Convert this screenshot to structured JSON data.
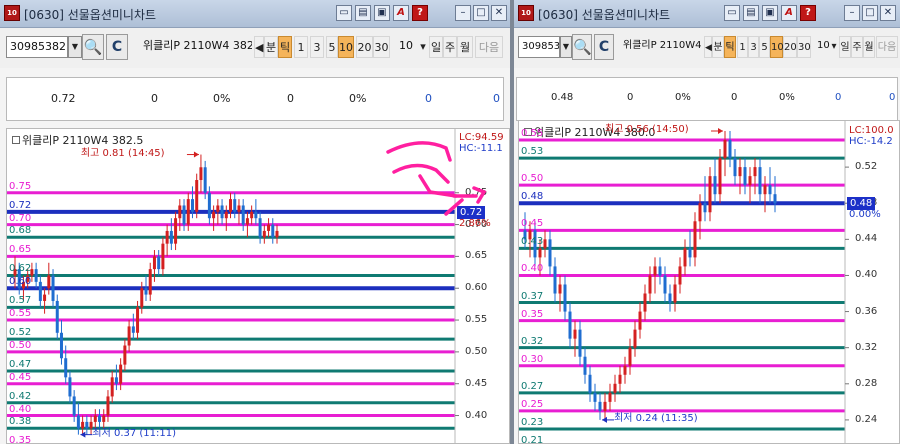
{
  "colors": {
    "magenta": "#e81ed2",
    "teal": "#0f7a72",
    "navy": "#1c2fbe",
    "up": "#d42020",
    "down": "#1f6dd0",
    "annotation": "#ff1fa0"
  },
  "left": {
    "title": "[0630] 선물옵션미니차트",
    "code": "30985382",
    "option_name": "위클리P 2110W4 382.5",
    "interval_buttons": [
      "분",
      "틱",
      "1",
      "3",
      "5",
      "10",
      "20",
      "30"
    ],
    "interval_value": "10",
    "period_buttons": [
      "일",
      "주",
      "월"
    ],
    "next_label": "다음",
    "readout": [
      "0.72",
      "0",
      "0%",
      "0",
      "0%",
      "0",
      "0"
    ],
    "chart_title": "위클리P 2110W4 382.5",
    "high_label": "최고 0.81 (14:45)",
    "low_label": "최저 0.37 (11:11)",
    "lc_label": "LC:94.59",
    "hc_label": "HC:-11.1",
    "current_price": "0.72",
    "change_pct": "2.86%",
    "y_ticks": [
      "0.75",
      "0.70",
      "0.65",
      "0.60",
      "0.55",
      "0.50",
      "0.45",
      "0.40"
    ],
    "level_labels": [
      "0.75",
      "0.72",
      "0.70",
      "0.68",
      "0.65",
      "0.62",
      "0.60",
      "0.57",
      "0.55",
      "0.52",
      "0.50",
      "0.47",
      "0.45",
      "0.42",
      "0.40",
      "0.38",
      "0.35"
    ]
  },
  "right": {
    "title": "[0630] 선물옵션미니차트",
    "code": "30985380",
    "option_name": "위클리P 2110W4 380",
    "interval_buttons": [
      "분",
      "틱",
      "1",
      "3",
      "5",
      "10",
      "20",
      "30"
    ],
    "interval_value": "10",
    "period_buttons": [
      "일",
      "주",
      "월"
    ],
    "next_label": "다음",
    "readout": [
      "0.48",
      "0",
      "0%",
      "0",
      "0%",
      "0",
      "0"
    ],
    "chart_title": "위클리P 2110W4 380.0",
    "high_label": "최고 0.56 (14:50)",
    "low_label": "최저 0.24 (11:35)",
    "lc_label": "LC:100.0",
    "hc_label": "HC:-14.2",
    "current_price": "0.48",
    "change_pct": "0.00%",
    "y_ticks": [
      "0.52",
      "0.48",
      "0.44",
      "0.40",
      "0.36",
      "0.32",
      "0.28",
      "0.24"
    ],
    "level_labels": [
      "0.55",
      "0.53",
      "0.50",
      "0.48",
      "0.45",
      "0.43",
      "0.40",
      "0.37",
      "0.35",
      "0.32",
      "0.30",
      "0.27",
      "0.25",
      "0.23",
      "0.21"
    ]
  },
  "chart_data": [
    {
      "type": "candlestick",
      "title": "위클리P 2110W4 382.5",
      "ylim": [
        0.36,
        0.825
      ],
      "y_ticks": [
        0.75,
        0.7,
        0.65,
        0.6,
        0.55,
        0.5,
        0.45,
        0.4
      ],
      "last": 0.72,
      "high": 0.81,
      "low": 0.37,
      "levels": [
        {
          "v": 0.75,
          "c": "m"
        },
        {
          "v": 0.72,
          "c": "n"
        },
        {
          "v": 0.7,
          "c": "m"
        },
        {
          "v": 0.68,
          "c": "t"
        },
        {
          "v": 0.65,
          "c": "m"
        },
        {
          "v": 0.62,
          "c": "t"
        },
        {
          "v": 0.6,
          "c": "n"
        },
        {
          "v": 0.57,
          "c": "t"
        },
        {
          "v": 0.55,
          "c": "m"
        },
        {
          "v": 0.52,
          "c": "t"
        },
        {
          "v": 0.5,
          "c": "m"
        },
        {
          "v": 0.47,
          "c": "t"
        },
        {
          "v": 0.45,
          "c": "m"
        },
        {
          "v": 0.42,
          "c": "t"
        },
        {
          "v": 0.4,
          "c": "m"
        },
        {
          "v": 0.38,
          "c": "t"
        },
        {
          "v": 0.35,
          "c": "m"
        }
      ],
      "candles": [
        [
          0.62,
          0.65,
          0.6,
          0.63
        ],
        [
          0.63,
          0.64,
          0.59,
          0.6
        ],
        [
          0.6,
          0.62,
          0.58,
          0.61
        ],
        [
          0.61,
          0.63,
          0.6,
          0.62
        ],
        [
          0.62,
          0.64,
          0.61,
          0.63
        ],
        [
          0.63,
          0.64,
          0.6,
          0.61
        ],
        [
          0.61,
          0.62,
          0.57,
          0.58
        ],
        [
          0.58,
          0.6,
          0.56,
          0.59
        ],
        [
          0.6,
          0.64,
          0.59,
          0.62
        ],
        [
          0.62,
          0.63,
          0.57,
          0.58
        ],
        [
          0.58,
          0.59,
          0.52,
          0.53
        ],
        [
          0.53,
          0.55,
          0.48,
          0.49
        ],
        [
          0.49,
          0.51,
          0.45,
          0.46
        ],
        [
          0.46,
          0.47,
          0.42,
          0.43
        ],
        [
          0.43,
          0.44,
          0.39,
          0.4
        ],
        [
          0.4,
          0.42,
          0.37,
          0.38
        ],
        [
          0.38,
          0.4,
          0.37,
          0.39
        ],
        [
          0.39,
          0.4,
          0.37,
          0.38
        ],
        [
          0.38,
          0.4,
          0.37,
          0.39
        ],
        [
          0.39,
          0.41,
          0.38,
          0.4
        ],
        [
          0.4,
          0.41,
          0.38,
          0.39
        ],
        [
          0.39,
          0.41,
          0.38,
          0.4
        ],
        [
          0.4,
          0.44,
          0.39,
          0.43
        ],
        [
          0.43,
          0.47,
          0.42,
          0.46
        ],
        [
          0.46,
          0.48,
          0.44,
          0.45
        ],
        [
          0.45,
          0.49,
          0.44,
          0.48
        ],
        [
          0.48,
          0.52,
          0.47,
          0.51
        ],
        [
          0.51,
          0.55,
          0.5,
          0.54
        ],
        [
          0.54,
          0.56,
          0.52,
          0.53
        ],
        [
          0.53,
          0.58,
          0.52,
          0.57
        ],
        [
          0.57,
          0.61,
          0.56,
          0.6
        ],
        [
          0.6,
          0.62,
          0.58,
          0.59
        ],
        [
          0.59,
          0.64,
          0.58,
          0.63
        ],
        [
          0.63,
          0.66,
          0.61,
          0.65
        ],
        [
          0.65,
          0.66,
          0.62,
          0.63
        ],
        [
          0.63,
          0.68,
          0.62,
          0.67
        ],
        [
          0.67,
          0.7,
          0.65,
          0.69
        ],
        [
          0.69,
          0.71,
          0.66,
          0.67
        ],
        [
          0.67,
          0.72,
          0.66,
          0.71
        ],
        [
          0.71,
          0.74,
          0.69,
          0.73
        ],
        [
          0.73,
          0.74,
          0.69,
          0.7
        ],
        [
          0.7,
          0.75,
          0.69,
          0.74
        ],
        [
          0.74,
          0.76,
          0.71,
          0.72
        ],
        [
          0.72,
          0.78,
          0.71,
          0.77
        ],
        [
          0.77,
          0.81,
          0.75,
          0.79
        ],
        [
          0.79,
          0.8,
          0.74,
          0.75
        ],
        [
          0.75,
          0.76,
          0.7,
          0.71
        ],
        [
          0.71,
          0.73,
          0.69,
          0.72
        ],
        [
          0.72,
          0.74,
          0.7,
          0.73
        ],
        [
          0.73,
          0.74,
          0.7,
          0.71
        ],
        [
          0.71,
          0.73,
          0.69,
          0.72
        ],
        [
          0.72,
          0.75,
          0.71,
          0.74
        ],
        [
          0.74,
          0.75,
          0.71,
          0.72
        ],
        [
          0.72,
          0.74,
          0.7,
          0.73
        ],
        [
          0.73,
          0.74,
          0.69,
          0.7
        ],
        [
          0.7,
          0.72,
          0.68,
          0.71
        ],
        [
          0.71,
          0.73,
          0.7,
          0.72
        ],
        [
          0.72,
          0.74,
          0.7,
          0.71
        ],
        [
          0.71,
          0.72,
          0.67,
          0.68
        ],
        [
          0.68,
          0.7,
          0.67,
          0.69
        ],
        [
          0.69,
          0.71,
          0.68,
          0.7
        ],
        [
          0.7,
          0.71,
          0.67,
          0.68
        ],
        [
          0.68,
          0.7,
          0.67,
          0.69
        ]
      ]
    },
    {
      "type": "candlestick",
      "title": "위클리P 2110W4 380.0",
      "ylim": [
        0.21,
        0.56
      ],
      "y_ticks": [
        0.52,
        0.48,
        0.44,
        0.4,
        0.36,
        0.32,
        0.28,
        0.24
      ],
      "last": 0.48,
      "high": 0.56,
      "low": 0.24,
      "levels": [
        {
          "v": 0.55,
          "c": "m"
        },
        {
          "v": 0.53,
          "c": "t"
        },
        {
          "v": 0.5,
          "c": "m"
        },
        {
          "v": 0.48,
          "c": "n"
        },
        {
          "v": 0.45,
          "c": "m"
        },
        {
          "v": 0.43,
          "c": "t"
        },
        {
          "v": 0.4,
          "c": "m"
        },
        {
          "v": 0.37,
          "c": "t"
        },
        {
          "v": 0.35,
          "c": "m"
        },
        {
          "v": 0.32,
          "c": "t"
        },
        {
          "v": 0.3,
          "c": "m"
        },
        {
          "v": 0.27,
          "c": "t"
        },
        {
          "v": 0.25,
          "c": "m"
        },
        {
          "v": 0.23,
          "c": "t"
        },
        {
          "v": 0.21,
          "c": "t"
        }
      ],
      "candles": [
        [
          0.45,
          0.47,
          0.43,
          0.44
        ],
        [
          0.44,
          0.46,
          0.42,
          0.45
        ],
        [
          0.45,
          0.46,
          0.41,
          0.42
        ],
        [
          0.42,
          0.44,
          0.4,
          0.43
        ],
        [
          0.43,
          0.45,
          0.42,
          0.44
        ],
        [
          0.44,
          0.45,
          0.4,
          0.41
        ],
        [
          0.41,
          0.42,
          0.37,
          0.38
        ],
        [
          0.38,
          0.4,
          0.36,
          0.39
        ],
        [
          0.39,
          0.4,
          0.35,
          0.36
        ],
        [
          0.36,
          0.37,
          0.32,
          0.33
        ],
        [
          0.33,
          0.35,
          0.31,
          0.34
        ],
        [
          0.34,
          0.35,
          0.3,
          0.31
        ],
        [
          0.31,
          0.32,
          0.28,
          0.29
        ],
        [
          0.29,
          0.3,
          0.26,
          0.27
        ],
        [
          0.27,
          0.28,
          0.25,
          0.26
        ],
        [
          0.26,
          0.27,
          0.24,
          0.25
        ],
        [
          0.25,
          0.27,
          0.24,
          0.26
        ],
        [
          0.26,
          0.28,
          0.25,
          0.27
        ],
        [
          0.27,
          0.29,
          0.26,
          0.28
        ],
        [
          0.28,
          0.3,
          0.27,
          0.29
        ],
        [
          0.29,
          0.31,
          0.28,
          0.3
        ],
        [
          0.3,
          0.33,
          0.29,
          0.32
        ],
        [
          0.32,
          0.35,
          0.31,
          0.34
        ],
        [
          0.34,
          0.37,
          0.33,
          0.36
        ],
        [
          0.36,
          0.39,
          0.35,
          0.38
        ],
        [
          0.38,
          0.41,
          0.37,
          0.4
        ],
        [
          0.4,
          0.42,
          0.38,
          0.41
        ],
        [
          0.41,
          0.42,
          0.39,
          0.4
        ],
        [
          0.4,
          0.41,
          0.37,
          0.38
        ],
        [
          0.38,
          0.39,
          0.36,
          0.37
        ],
        [
          0.37,
          0.4,
          0.36,
          0.39
        ],
        [
          0.39,
          0.42,
          0.38,
          0.41
        ],
        [
          0.41,
          0.44,
          0.4,
          0.43
        ],
        [
          0.43,
          0.45,
          0.41,
          0.42
        ],
        [
          0.42,
          0.47,
          0.41,
          0.46
        ],
        [
          0.46,
          0.49,
          0.44,
          0.48
        ],
        [
          0.48,
          0.51,
          0.46,
          0.47
        ],
        [
          0.47,
          0.52,
          0.46,
          0.51
        ],
        [
          0.51,
          0.53,
          0.48,
          0.49
        ],
        [
          0.49,
          0.54,
          0.48,
          0.53
        ],
        [
          0.53,
          0.56,
          0.51,
          0.55
        ],
        [
          0.55,
          0.56,
          0.52,
          0.53
        ],
        [
          0.53,
          0.54,
          0.5,
          0.51
        ],
        [
          0.51,
          0.53,
          0.49,
          0.52
        ],
        [
          0.52,
          0.53,
          0.49,
          0.5
        ],
        [
          0.5,
          0.52,
          0.48,
          0.51
        ],
        [
          0.51,
          0.53,
          0.49,
          0.52
        ],
        [
          0.52,
          0.53,
          0.48,
          0.49
        ],
        [
          0.49,
          0.51,
          0.47,
          0.5
        ],
        [
          0.5,
          0.52,
          0.48,
          0.49
        ],
        [
          0.49,
          0.51,
          0.47,
          0.48
        ]
      ]
    }
  ]
}
